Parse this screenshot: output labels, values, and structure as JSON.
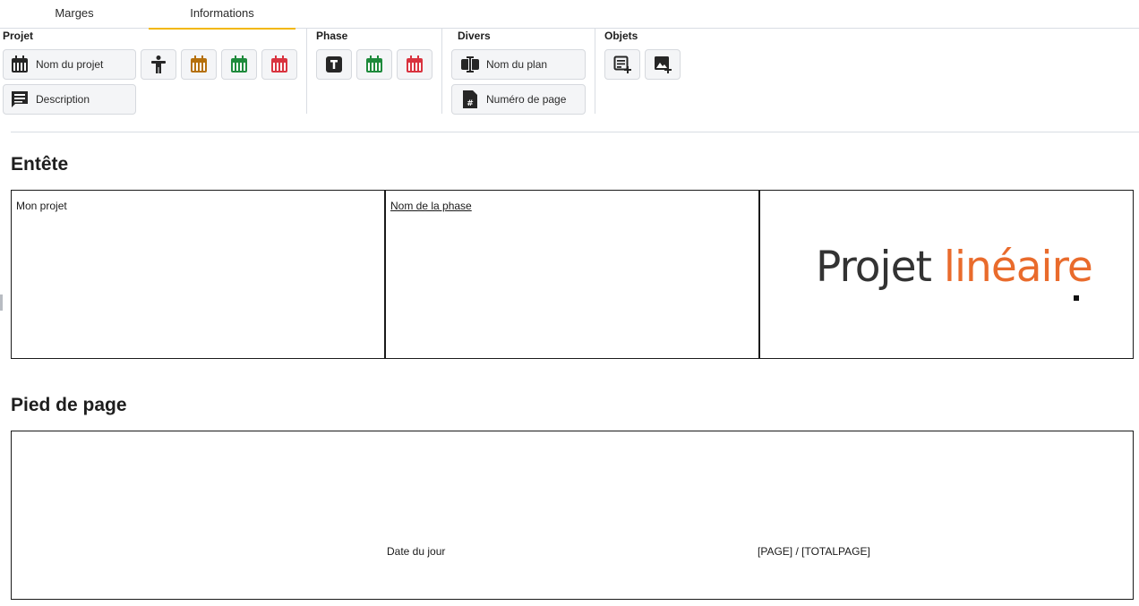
{
  "tabs": [
    {
      "label": "Marges",
      "active": false
    },
    {
      "label": "Informations",
      "active": true
    }
  ],
  "accent_color": "#f2b705",
  "ribbon": {
    "projet": {
      "title": "Projet",
      "nom_du_projet": "Nom du projet",
      "description": "Description",
      "icons": [
        "calendar-dark-icon",
        "person-icon",
        "calendar-orange-icon",
        "calendar-green-icon",
        "calendar-red-icon",
        "comment-icon"
      ]
    },
    "phase": {
      "title": "Phase",
      "icons": [
        "text-t-icon",
        "calendar-green-icon",
        "calendar-red-icon"
      ]
    },
    "divers": {
      "title": "Divers",
      "nom_du_plan": "Nom du plan",
      "numero_de_page": "Numéro de page",
      "icons": [
        "text-cursor-icon",
        "page-number-icon"
      ]
    },
    "objets": {
      "title": "Objets",
      "icons": [
        "add-text-icon",
        "add-image-icon"
      ]
    }
  },
  "colors": {
    "orange": "#b5700c",
    "green": "#1e8a3c",
    "red": "#d9333f",
    "dark": "#262626",
    "logo_orange": "#e96b2c",
    "logo_gray": "#333333"
  },
  "header": {
    "title": "Entête",
    "cell1": "Mon projet",
    "cell2": "Nom de la phase",
    "logo_part1": "Projet",
    "logo_part2": "linéaire"
  },
  "footer": {
    "title": "Pied de page",
    "date": "Date du jour",
    "page": "[PAGE] / [TOTALPAGE]"
  }
}
